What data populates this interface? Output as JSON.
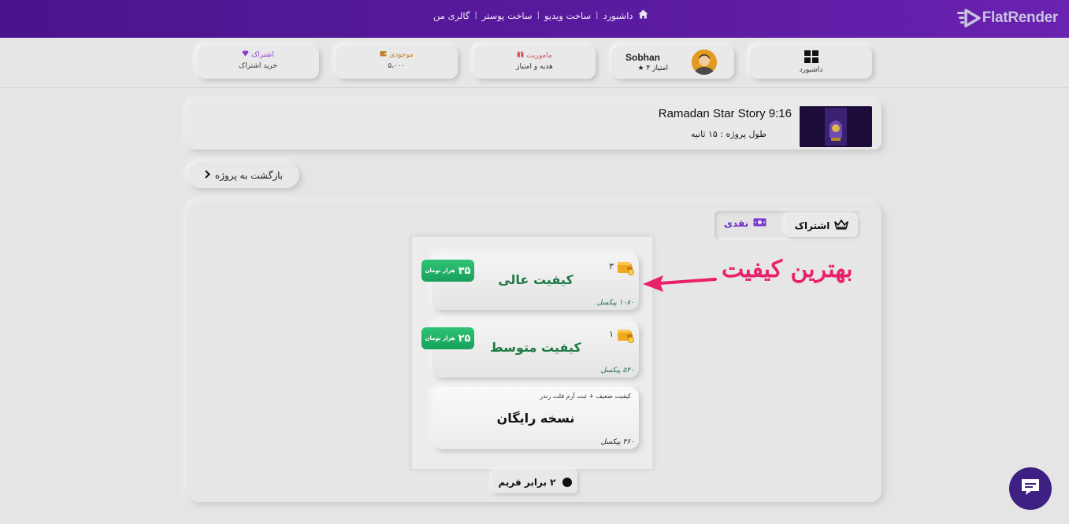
{
  "brand": {
    "name": "FlatRender",
    "accent": "#5b1ba0"
  },
  "topnav": {
    "items": [
      "داشبورد",
      "ساخت ویدیو",
      "ساخت پوستر",
      "گالری من"
    ],
    "home_icon": "home-icon"
  },
  "stats": {
    "dashboard": {
      "label": "داشبورد",
      "icon": "grid-icon"
    },
    "user": {
      "name": "Sobhan",
      "score": "۴ امتیاز",
      "icon": "star-icon"
    },
    "mission": {
      "title": "ماموریت",
      "value": "هدیه و امتیاز",
      "icon": "gift-icon",
      "color": "#d05a5a"
    },
    "balance": {
      "title": "موجودی",
      "value": "۵،۰۰۰",
      "icon": "wallet-icon",
      "color": "#c0802a"
    },
    "subscription": {
      "title": "اشتراک",
      "value": "خرید اشتراک",
      "icon": "diamond-icon",
      "color": "#8a3bd0"
    }
  },
  "project": {
    "title": "Ramadan Star Story 9:16",
    "length": "طول پروژه : ۱۵ ثانیه"
  },
  "back_button": {
    "label": "بازگشت به پروژه"
  },
  "payment_toggle": {
    "subscription": "اشتراک",
    "cash": "نقدی",
    "selected": "subscription"
  },
  "annotation": {
    "text": "بهترین کیفیت",
    "color": "#e8216a"
  },
  "quality_options": [
    {
      "name": "کیفیت عالی",
      "price": "۳۵",
      "unit": "هزار تومان",
      "coins": "۳",
      "resolution": "۱۰۸۰ پیکسل"
    },
    {
      "name": "کیفیت متوسط",
      "price": "۲۵",
      "unit": "هزار تومان",
      "coins": "۱",
      "resolution": "۵۴۰ پیکسل"
    },
    {
      "name": "نسخه رایگان",
      "note": "کیفیت ضعیف + ثبت آرم فلت رندر",
      "resolution": "۳۶۰ پیکسل"
    }
  ],
  "frame_button": {
    "label": "۲ برابر فریم"
  },
  "chat": {
    "icon": "chat-icon"
  }
}
